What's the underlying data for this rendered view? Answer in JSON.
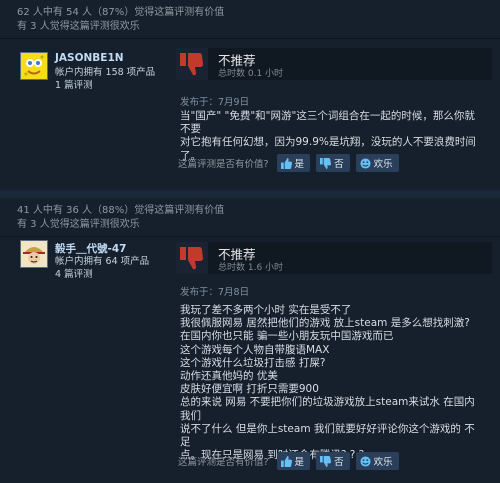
{
  "reviews": [
    {
      "helpful_line": "62 人中有 54 人（87%）觉得这篇评测有价值",
      "funny_line": "有 3 人觉得这篇评测很欢乐",
      "author": {
        "name": "JASONBE1N",
        "products": "帐户内拥有 158 项产品",
        "reviews": "1 篇评测"
      },
      "verdict": "不推荐",
      "hours": "总时数 0.1 小时",
      "posted": "发布于：7月9日",
      "body": [
        "当\"国产\" \"免费\"和\"网游\"这三个词组合在一起的时候，那么你就不要",
        "对它抱有任何幻想，因为99.9%是坑翔，没玩的人不要浪费时间了。"
      ],
      "vote": {
        "question": "这篇评测是否有价值?",
        "yes": "是",
        "no": "否",
        "funny": "欢乐"
      }
    },
    {
      "helpful_line": "41 人中有 36 人（88%）觉得这篇评测有价值",
      "funny_line": "有 3 人觉得这篇评测很欢乐",
      "author": {
        "name": "毅手＿代號-47",
        "products": "帐户内拥有 64 项产品",
        "reviews": "4 篇评测"
      },
      "verdict": "不推荐",
      "hours": "总时数 1.6 小时",
      "posted": "发布于：7月8日",
      "body": [
        "我玩了差不多两个小时 实在是受不了",
        "我很佩服网易 居然把他们的游戏 放上steam 是多么想找刺激?",
        "在国内你也只能 骗一些小朋友玩中国游戏而已",
        "这个游戏每个人物自带腹语MAX",
        "这个游戏什么垃圾打击感 打屎?",
        "动作还真他妈的 优美",
        "皮肤好便宜啊 打折只需要900",
        "总的来说 网易 不要把你们的垃圾游戏放上steam来试水 在国内我们",
        "说不了什么 但是你上steam 我们就要好好评论你这个游戏的 不足",
        "点。现在只是网易 到时还会有腾讯? ? ?"
      ],
      "vote": {
        "question": "这篇评测是否有价值?",
        "yes": "是",
        "no": "否",
        "funny": "欢乐"
      }
    }
  ],
  "icons": {
    "thumb": "thumbs-down-icon",
    "vote_yes": "thumbs-up-icon",
    "vote_no": "thumbs-down-small-icon",
    "vote_funny": "smiley-icon"
  },
  "colors": {
    "background": "#1b2838",
    "panel": "#16202d",
    "thumb_red": "#c13a2c",
    "link_blue": "#66c0f4"
  }
}
